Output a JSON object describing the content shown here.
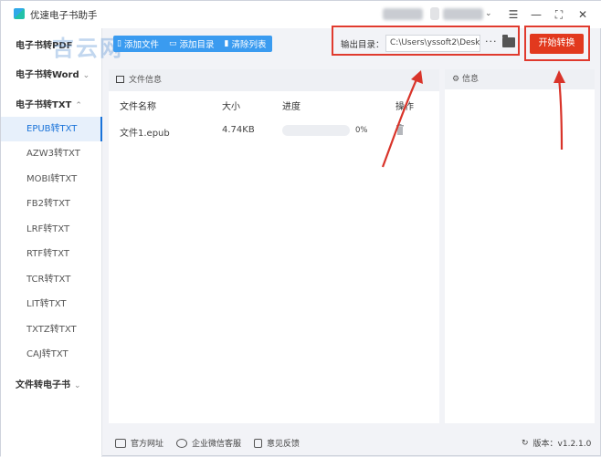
{
  "app": {
    "title": "优速电子书助手"
  },
  "watermark": "吉云网",
  "sidebar": {
    "groups": [
      {
        "label": "电子书转PDF",
        "chevron": ""
      },
      {
        "label": "电子书转Word",
        "chevron": "⌄"
      },
      {
        "label": "电子书转TXT",
        "chevron": "⌃"
      },
      {
        "label": "文件转电子书",
        "chevron": "⌄"
      }
    ],
    "items": [
      "EPUB转TXT",
      "AZW3转TXT",
      "MOBI转TXT",
      "FB2转TXT",
      "LRF转TXT",
      "RTF转TXT",
      "TCR转TXT",
      "LIT转TXT",
      "TXTZ转TXT",
      "CAJ转TXT"
    ],
    "active_index": 0
  },
  "toolbar": {
    "add_file": "添加文件",
    "add_folder": "添加目录",
    "clear_list": "清除列表"
  },
  "output": {
    "label": "输出目录：",
    "path": "C:\\Users\\yssoft2\\Deskt",
    "more": "···"
  },
  "start_button": "开始转换",
  "file_panel": {
    "title": "文件信息",
    "columns": {
      "name": "文件名称",
      "size": "大小",
      "progress": "进度",
      "action": "操作"
    },
    "rows": [
      {
        "name": "文件1.epub",
        "size": "4.74KB",
        "progress_text": "0%",
        "progress": 0
      }
    ]
  },
  "info_panel": {
    "title": "信息"
  },
  "footer": {
    "website": "官方网址",
    "wechat": "企业微信客服",
    "feedback": "意见反馈",
    "version": "版本：v1.2.1.0"
  }
}
